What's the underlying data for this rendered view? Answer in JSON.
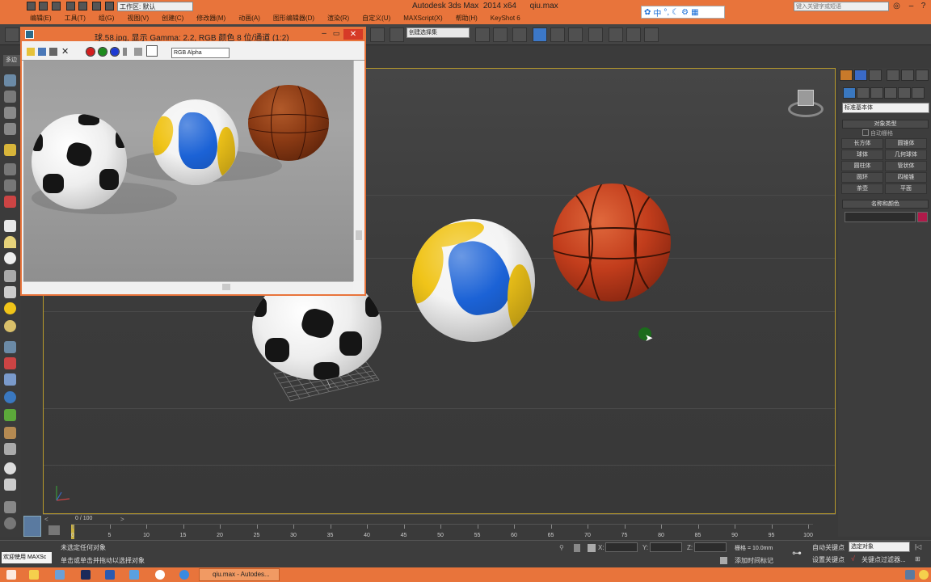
{
  "window": {
    "app_title": "Autodesk 3ds Max  2014 x64      qiu.max",
    "workspace": "工作区: 默认",
    "help_search_placeholder": "键入关键字或短语"
  },
  "menu": [
    "编辑(E)",
    "工具(T)",
    "组(G)",
    "视图(V)",
    "创建(C)",
    "修改器(M)",
    "动画(A)",
    "图形编辑器(D)",
    "渲染(R)",
    "自定义(U)",
    "MAXScript(X)",
    "帮助(H)",
    "KeyShot 6"
  ],
  "toolbar": {
    "selection_set_placeholder": "创建选择集",
    "ribbon_tab": "多边"
  },
  "render_window": {
    "title": "球.58.jpg, 显示 Gamma: 2.2, RGB 颜色 8 位/通道 (1:2)",
    "channel": "RGB Alpha"
  },
  "command_panel": {
    "category": "标准基本体",
    "object_type_header": "对象类型",
    "autogrid": "自动栅格",
    "objects": [
      "长方体",
      "圆锥体",
      "球体",
      "几何球体",
      "圆柱体",
      "管状体",
      "圆环",
      "四棱锥",
      "茶壶",
      "平面"
    ],
    "name_color_header": "名称和颜色"
  },
  "timeline": {
    "frame_label": "0 / 100",
    "ticks": [
      "0",
      "5",
      "10",
      "15",
      "20",
      "25",
      "30",
      "35",
      "40",
      "45",
      "50",
      "55",
      "60",
      "65",
      "70",
      "75",
      "80",
      "85",
      "90",
      "95",
      "100"
    ]
  },
  "status": {
    "welcome": "欢迎使用 MAXSc",
    "line1": "未选定任何对象",
    "line2": "单击或单击并拖动以选择对象",
    "x_label": "X:",
    "y_label": "Y:",
    "z_label": "Z:",
    "grid": "栅格 = 10.0mm",
    "add_time_tag": "添加时间标记",
    "auto_key": "自动关键点",
    "set_key": "设置关键点",
    "selected_objects": "选定对象",
    "key_filters": "关键点过滤器..."
  },
  "taskbar": {
    "active_task": "qiu.max - Autodes..."
  },
  "colors": {
    "accent_orange": "#e8743b",
    "viewport_border": "#b89a2b",
    "basketball": "#c23d1c",
    "volleyball_blue": "#1b62d6",
    "volleyball_yellow": "#f0c419"
  }
}
